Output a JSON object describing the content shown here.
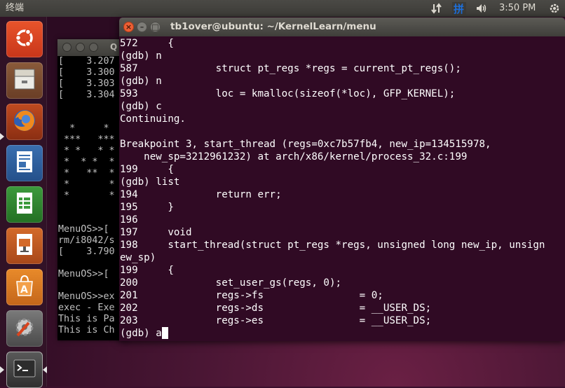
{
  "top_panel": {
    "title": "终端",
    "clock": "3:50 PM",
    "tray_icons": [
      "network-updown-icon",
      "input-method-icon",
      "volume-icon",
      "power-gear-icon"
    ]
  },
  "launcher": {
    "items": [
      {
        "name": "dash-home",
        "icon": "ubuntu-logo-icon"
      },
      {
        "name": "files",
        "icon": "file-cabinet-icon"
      },
      {
        "name": "firefox",
        "icon": "firefox-icon"
      },
      {
        "name": "libreoffice-writer",
        "icon": "writer-document-icon"
      },
      {
        "name": "libreoffice-calc",
        "icon": "calc-spreadsheet-icon"
      },
      {
        "name": "libreoffice-impress",
        "icon": "impress-presentation-icon"
      },
      {
        "name": "software-center",
        "icon": "shopping-bag-icon"
      },
      {
        "name": "system-settings",
        "icon": "wrench-gear-icon"
      },
      {
        "name": "terminal",
        "icon": "terminal-icon"
      }
    ]
  },
  "qemu_window": {
    "title": "Q",
    "screen_lines": [
      "[    3.207",
      "[    3.300",
      "[    3.303",
      "[    3.304",
      "",
      "",
      "  *     *",
      " ***   ***",
      " * *   * *",
      " *  * *  *",
      " *   **  *",
      " *       *",
      " *       *",
      "",
      "",
      "MenuOS>>[",
      "rm/i8042/s",
      "[    3.790",
      "",
      "MenuOS>>[",
      "",
      "MenuOS>>ex",
      "exec - Exe",
      "This is Pa",
      "This is Ch",
      "_"
    ]
  },
  "terminal": {
    "title": "tb1over@ubuntu: ~/KernelLearn/menu",
    "lines": [
      "572     {",
      "(gdb) n",
      "587             struct pt_regs *regs = current_pt_regs();",
      "(gdb) n",
      "593             loc = kmalloc(sizeof(*loc), GFP_KERNEL);",
      "(gdb) c",
      "Continuing.",
      "",
      "Breakpoint 3, start_thread (regs=0xc7b57fb4, new_ip=134515978,",
      "    new_sp=3212961232) at arch/x86/kernel/process_32.c:199",
      "199     {",
      "(gdb) list",
      "194             return err;",
      "195     }",
      "196",
      "197     void",
      "198     start_thread(struct pt_regs *regs, unsigned long new_ip, unsign",
      "ew_sp)",
      "199     {",
      "200             set_user_gs(regs, 0);",
      "201             regs->fs                = 0;",
      "202             regs->ds                = __USER_DS;",
      "203             regs->es                = __USER_DS;"
    ],
    "prompt": "(gdb) a"
  }
}
